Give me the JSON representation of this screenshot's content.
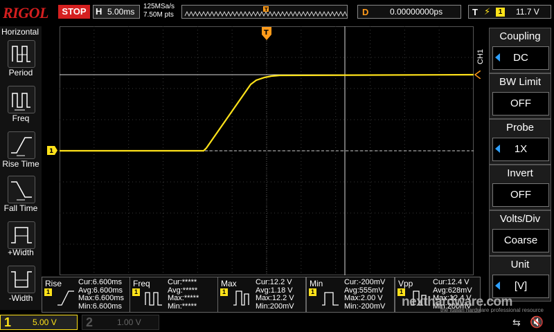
{
  "header": {
    "brand": "RIGOL",
    "run_state": "STOP",
    "timebase_label": "H",
    "timebase_value": "5.00ms",
    "sample_rate": "125MSa/s",
    "memory_depth": "7.50M pts",
    "delay_label": "D",
    "delay_value": "0.00000000ps",
    "trigger_label": "T",
    "trigger_channel": "1",
    "trigger_level": "11.7 V"
  },
  "left_panel": {
    "title": "Horizontal",
    "items": [
      {
        "label": "Period",
        "icon": "period-icon"
      },
      {
        "label": "Freq",
        "icon": "freq-icon"
      },
      {
        "label": "Rise Time",
        "icon": "rise-time-icon"
      },
      {
        "label": "Fall Time",
        "icon": "fall-time-icon"
      },
      {
        "label": "+Width",
        "icon": "positive-width-icon"
      },
      {
        "label": "-Width",
        "icon": "negative-width-icon"
      }
    ]
  },
  "display": {
    "trigger_marker": "T",
    "channel_marker": "1",
    "channel_tag": "CH1"
  },
  "right_panel": {
    "items": [
      {
        "title": "Coupling",
        "value": "DC"
      },
      {
        "title": "BW Limit",
        "value": "OFF"
      },
      {
        "title": "Probe",
        "value": "1X"
      },
      {
        "title": "Invert",
        "value": "OFF"
      },
      {
        "title": "Volts/Div",
        "value": "Coarse"
      },
      {
        "title": "Unit",
        "value": "[V]"
      }
    ]
  },
  "measurements": [
    {
      "name": "Rise",
      "source": "1",
      "lines": [
        "Cur:6.600ms",
        "Avg:6.600ms",
        "Max:6.600ms",
        "Min:6.600ms"
      ]
    },
    {
      "name": "Freq",
      "source": "1",
      "lines": [
        "Cur:*****",
        "Avg:*****",
        "Max:*****",
        "Min:*****"
      ]
    },
    {
      "name": "Max",
      "source": "1",
      "lines": [
        "Cur:12.2 V",
        "Avg:1.18 V",
        "Max:12.2 V",
        "Min:200mV"
      ]
    },
    {
      "name": "Min",
      "source": "1",
      "lines": [
        "Cur:-200mV",
        "Avg:555mV",
        "Max:2.00 V",
        "Min:-200mV"
      ]
    },
    {
      "name": "Vpp",
      "source": "1",
      "lines": [
        "Cur:12.4 V",
        "Avg:628mV",
        "Max:12.4 V",
        "Min:200mV"
      ]
    }
  ],
  "bottom": {
    "ch1_number": "1",
    "ch1_scale": "5.00 V",
    "ch2_number": "2",
    "ch2_scale": "1.00 V"
  },
  "watermark": {
    "text": "nexthardware.com",
    "subtext": "the Italian hardware professional resource"
  },
  "colors": {
    "ch1": "#ffe21a",
    "trigger": "#ff9a1a",
    "stop": "#d52020",
    "brand": "#d51f1f",
    "arrow": "#2ea0ff"
  }
}
